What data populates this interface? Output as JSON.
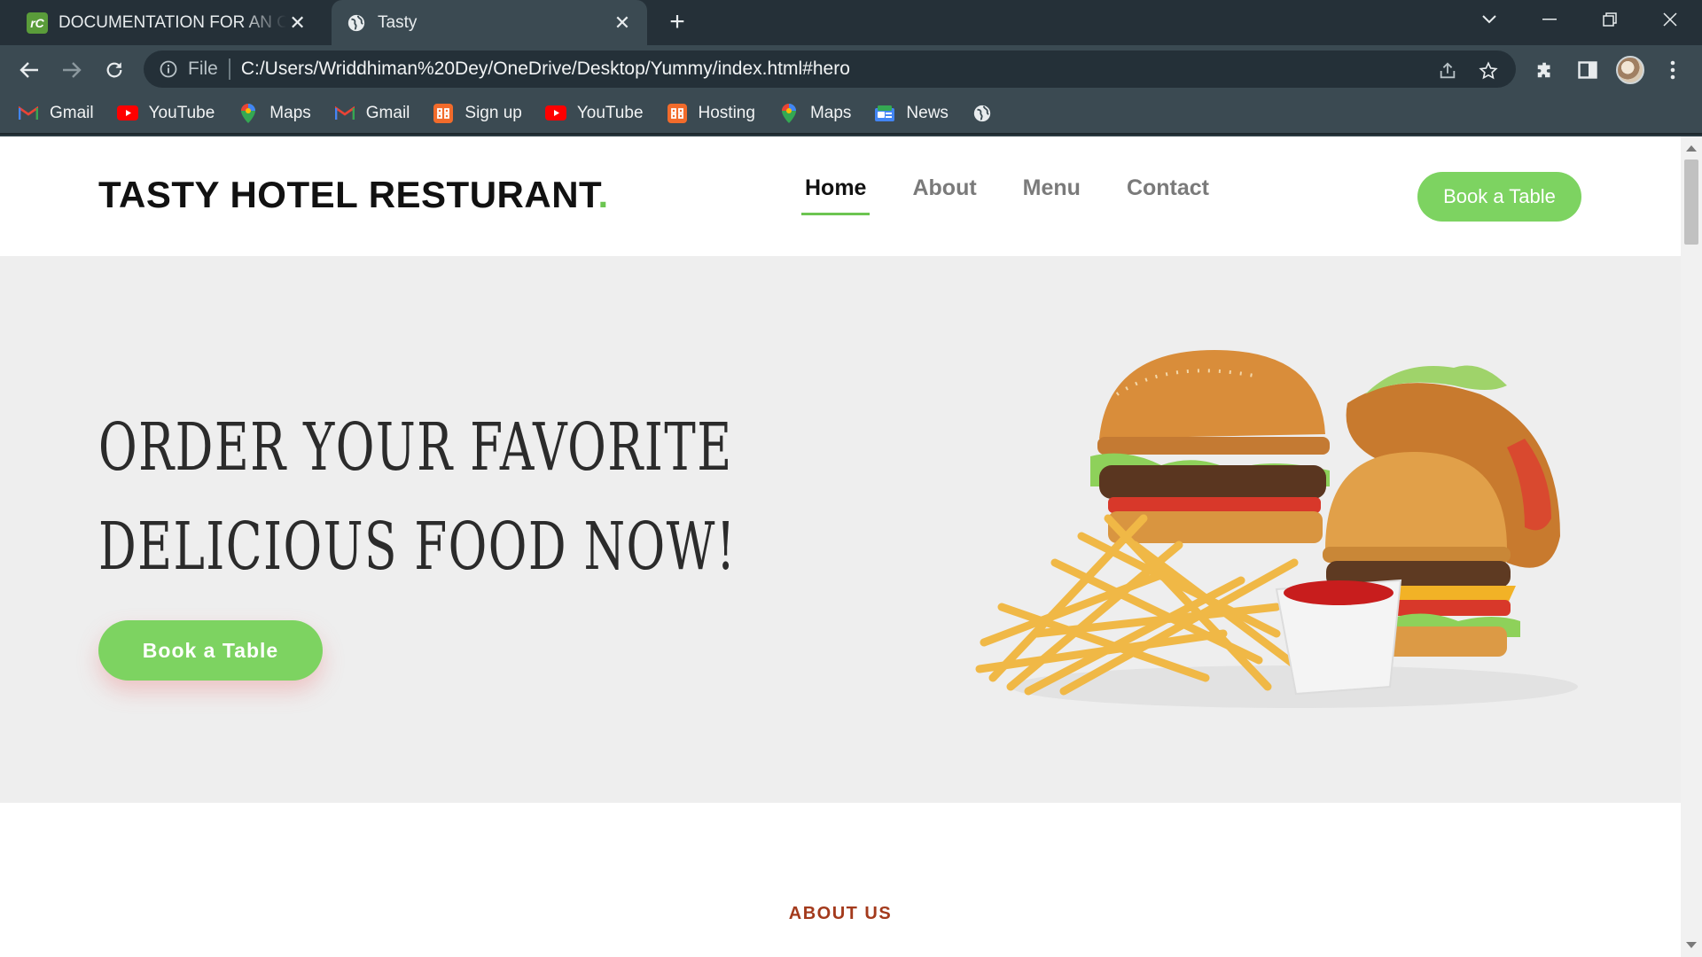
{
  "browser": {
    "tabs": [
      {
        "title": "DOCUMENTATION FOR AN ONLI",
        "favicon": "rc-icon",
        "active": false
      },
      {
        "title": "Tasty",
        "favicon": "globe-icon",
        "active": true
      }
    ],
    "address": {
      "scheme_label": "File",
      "url": "C:/Users/Wriddhiman%20Dey/OneDrive/Desktop/Yummy/index.html#hero"
    },
    "bookmarks": [
      {
        "label": "Gmail",
        "icon": "gmail-icon"
      },
      {
        "label": "YouTube",
        "icon": "youtube-icon"
      },
      {
        "label": "Maps",
        "icon": "maps-icon"
      },
      {
        "label": "Gmail",
        "icon": "gmail-icon"
      },
      {
        "label": "Sign up",
        "icon": "hosting-icon"
      },
      {
        "label": "YouTube",
        "icon": "youtube-icon"
      },
      {
        "label": "Hosting",
        "icon": "hosting-icon"
      },
      {
        "label": "Maps",
        "icon": "maps-icon"
      },
      {
        "label": "News",
        "icon": "news-icon"
      },
      {
        "label": "",
        "icon": "globe-icon"
      }
    ]
  },
  "site": {
    "logo_text": "TASTY HOTEL RESTURANT",
    "logo_dot": ".",
    "nav": [
      {
        "label": "Home",
        "active": true
      },
      {
        "label": "About",
        "active": false
      },
      {
        "label": "Menu",
        "active": false
      },
      {
        "label": "Contact",
        "active": false
      }
    ],
    "header_button": "Book a Table",
    "hero": {
      "line1": "ORDER YOUR FAVORITE",
      "line2": "DELICIOUS FOOD NOW!",
      "button": "Book a Table"
    },
    "about_label": "ABOUT US"
  },
  "colors": {
    "accent": "#7dd361",
    "about_label": "#a33a1c",
    "hero_bg": "#eeeeee"
  }
}
